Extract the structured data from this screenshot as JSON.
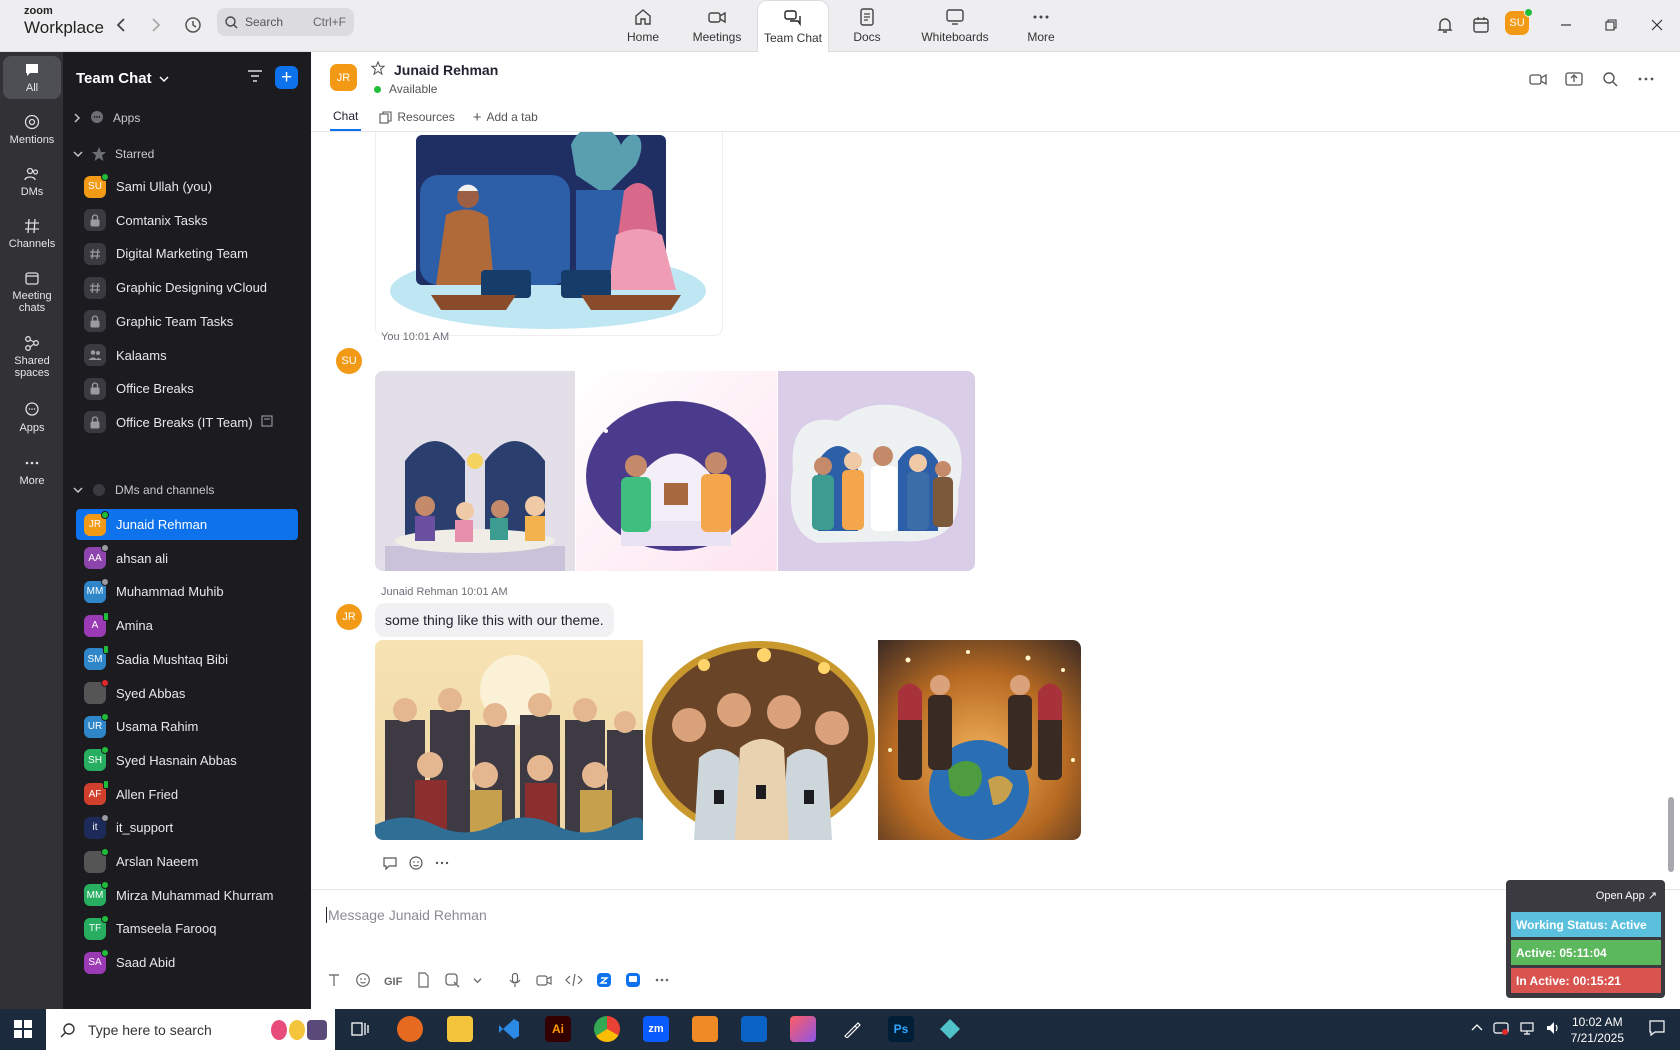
{
  "app": {
    "brand_small": "zoom",
    "brand_big": "Workplace",
    "search_label": "Search",
    "search_shortcut": "Ctrl+F",
    "nav": [
      {
        "label": "Home",
        "icon": "home-icon"
      },
      {
        "label": "Meetings",
        "icon": "video-icon"
      },
      {
        "label": "Team Chat",
        "icon": "chat-icon",
        "active": true
      },
      {
        "label": "Docs",
        "icon": "document-icon"
      },
      {
        "label": "Whiteboards",
        "icon": "whiteboard-icon"
      },
      {
        "label": "More",
        "icon": "more-dots-icon"
      }
    ],
    "user_initials": "SU"
  },
  "rail": [
    {
      "label": "All",
      "active": true
    },
    {
      "label": "Mentions"
    },
    {
      "label": "DMs"
    },
    {
      "label": "Channels"
    },
    {
      "label": "Meeting chats"
    },
    {
      "label": "Shared spaces"
    },
    {
      "label": "Apps"
    },
    {
      "label": "More"
    }
  ],
  "sidebar": {
    "title": "Team Chat",
    "apps_label": "Apps",
    "starred_label": "Starred",
    "starred": [
      {
        "initials": "SU",
        "label": "Sami Ullah (you)",
        "color": "#f29a16",
        "status": "on"
      },
      {
        "icon": "lock-icon",
        "label": "Comtanix Tasks"
      },
      {
        "icon": "hash-icon",
        "label": "Digital Marketing Team"
      },
      {
        "icon": "hash-icon",
        "label": "Graphic Designing vCloud"
      },
      {
        "icon": "lock-icon",
        "label": "Graphic Team Tasks"
      },
      {
        "icon": "group-icon",
        "label": "Kalaams"
      },
      {
        "icon": "lock-icon",
        "label": "Office Breaks"
      },
      {
        "icon": "lock-icon",
        "label": "Office Breaks (IT Team)"
      }
    ],
    "dms_label": "DMs and channels",
    "dms": [
      {
        "initials": "JR",
        "label": "Junaid Rehman",
        "color": "#f29a16",
        "status": "on",
        "active": true
      },
      {
        "initials": "AA",
        "label": "ahsan ali",
        "color": "#8e44ad",
        "status": "off"
      },
      {
        "initials": "MM",
        "label": "Muhammad Muhib",
        "color": "#2f86c8",
        "status": "off"
      },
      {
        "initials": "A",
        "label": "Amina",
        "color": "#9b3ab5",
        "status": "mob"
      },
      {
        "initials": "SM",
        "label": "Sadia Mushtaq Bibi",
        "color": "#2f86c8",
        "status": "mob"
      },
      {
        "initials": "",
        "label": "Syed Abbas",
        "color": "#555",
        "status": "busy"
      },
      {
        "initials": "UR",
        "label": "Usama Rahim",
        "color": "#2f86c8",
        "status": "on"
      },
      {
        "initials": "SH",
        "label": "Syed Hasnain Abbas",
        "color": "#27ae60",
        "status": "on"
      },
      {
        "initials": "AF",
        "label": "Allen Fried",
        "color": "#d0402c",
        "status": "mob"
      },
      {
        "initials": "it",
        "label": "it_support",
        "color": "#1d2b5a",
        "status": "off"
      },
      {
        "initials": "",
        "label": "Arslan Naeem",
        "color": "#555",
        "status": "on"
      },
      {
        "initials": "MM",
        "label": "Mirza Muhammad Khurram",
        "color": "#27ae60",
        "status": "on"
      },
      {
        "initials": "TF",
        "label": "Tamseela Farooq",
        "color": "#27ae60",
        "status": "on"
      },
      {
        "initials": "SA",
        "label": "Saad Abid",
        "color": "#9b3ab5",
        "status": "on"
      }
    ]
  },
  "chat": {
    "name": "Junaid Rehman",
    "initials": "JR",
    "status": "Available",
    "tabs": [
      "Chat",
      "Resources",
      "Add a tab"
    ],
    "messages": [
      {
        "author": "You",
        "time": "10:01 AM",
        "initials": "SU"
      },
      {
        "author": "Junaid Rehman",
        "time": "10:01 AM",
        "initials": "JR",
        "text": "some thing like this with our theme."
      }
    ],
    "composer_placeholder": "Message Junaid Rehman",
    "gif_label": "GIF"
  },
  "widget": {
    "open_label": "Open App ↗",
    "working": "Working Status: Active",
    "active": "Active: 05:11:04",
    "inactive": "In Active: 00:15:21",
    "colors": {
      "working": "#5bc0de",
      "active": "#5cb85c",
      "inactive": "#d9534f"
    }
  },
  "taskbar": {
    "search_placeholder": "Type here to search",
    "time": "10:02 AM",
    "date": "7/21/2025",
    "apps": [
      "Ai",
      "zm",
      "Ps"
    ]
  }
}
